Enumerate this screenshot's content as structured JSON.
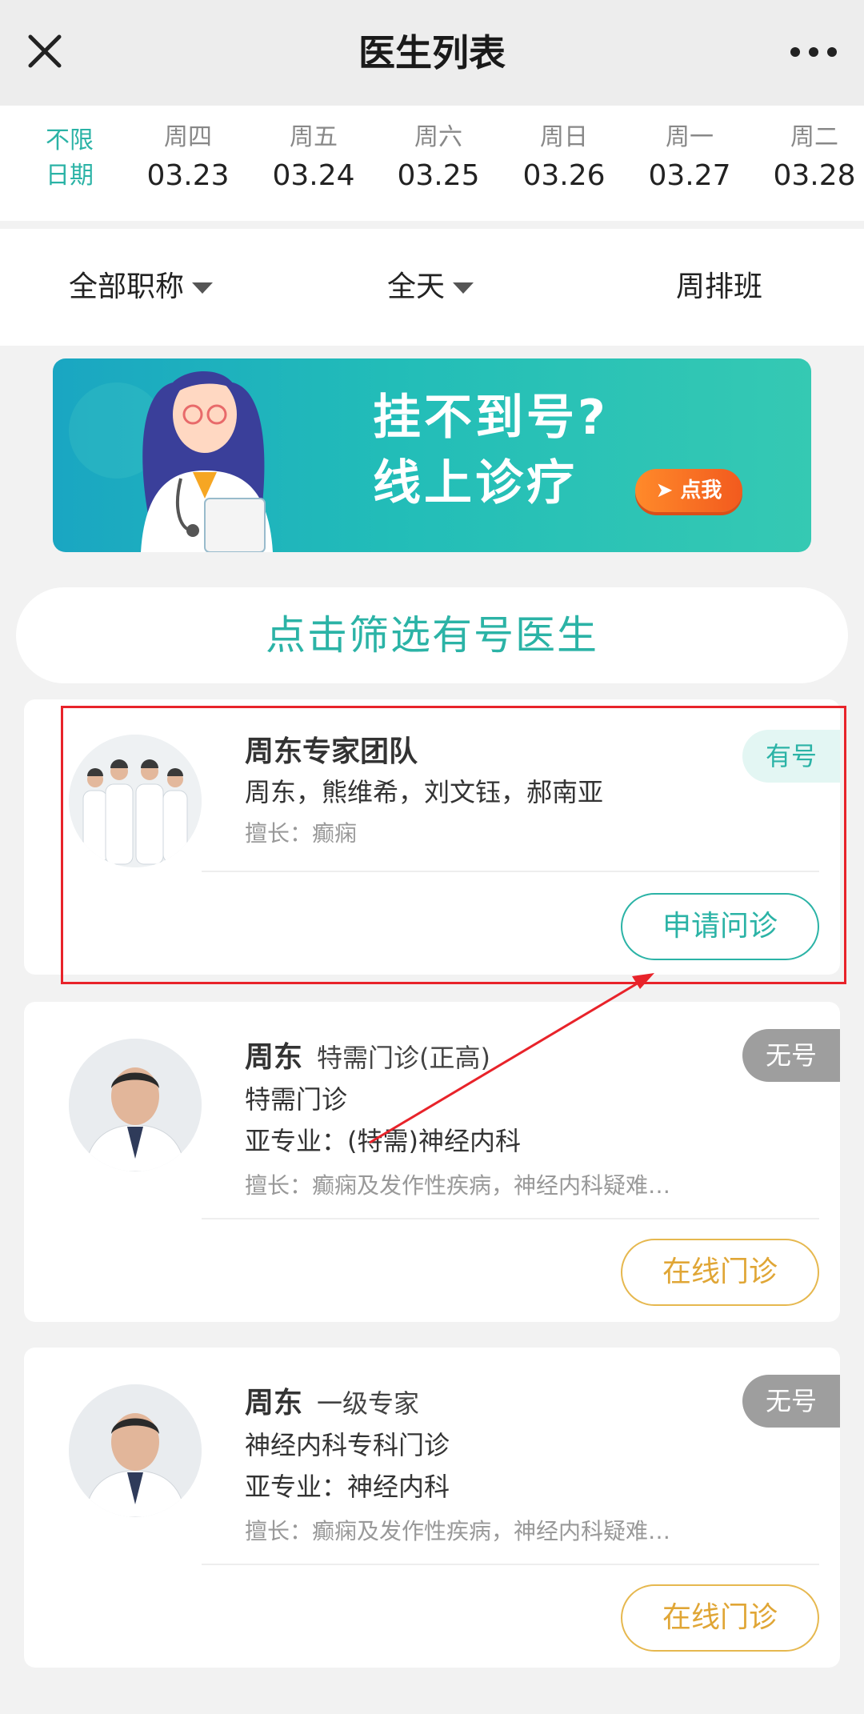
{
  "topbar": {
    "title": "医生列表"
  },
  "dates": {
    "unlimited_line1": "不限",
    "unlimited_line2": "日期",
    "items": [
      {
        "weekday": "周四",
        "date": "03.23"
      },
      {
        "weekday": "周五",
        "date": "03.24"
      },
      {
        "weekday": "周六",
        "date": "03.25"
      },
      {
        "weekday": "周日",
        "date": "03.26"
      },
      {
        "weekday": "周一",
        "date": "03.27"
      },
      {
        "weekday": "周二",
        "date": "03.28"
      }
    ]
  },
  "filters": {
    "title_filter": "全部职称",
    "time_filter": "全天",
    "schedule": "周排班"
  },
  "banner": {
    "line1": "挂不到号?",
    "line2": "线上诊疗",
    "cta": "点我"
  },
  "filter_available": "点击筛选有号医生",
  "doctors": [
    {
      "name": "周东专家团队",
      "members": "周东，熊维希，刘文钰，郝南亚",
      "specialty": "擅长：癫痫",
      "badge": "有号",
      "button": "申请问诊"
    },
    {
      "name": "周东",
      "title": "特需门诊(正高)",
      "clinic": "特需门诊",
      "subspecialty": "亚专业：(特需)神经内科",
      "specialty": "擅长：癫痫及发作性疾病，神经内科疑难…",
      "badge": "无号",
      "button": "在线门诊"
    },
    {
      "name": "周东",
      "title": "一级专家",
      "clinic": "神经内科专科门诊",
      "subspecialty": "亚专业：神经内科",
      "specialty": "擅长：癫痫及发作性疾病，神经内科疑难…",
      "badge": "无号",
      "button": "在线门诊"
    }
  ],
  "colors": {
    "accent": "#2bb3a6",
    "gold": "#e0a636",
    "annotation_red": "#e8232a"
  }
}
